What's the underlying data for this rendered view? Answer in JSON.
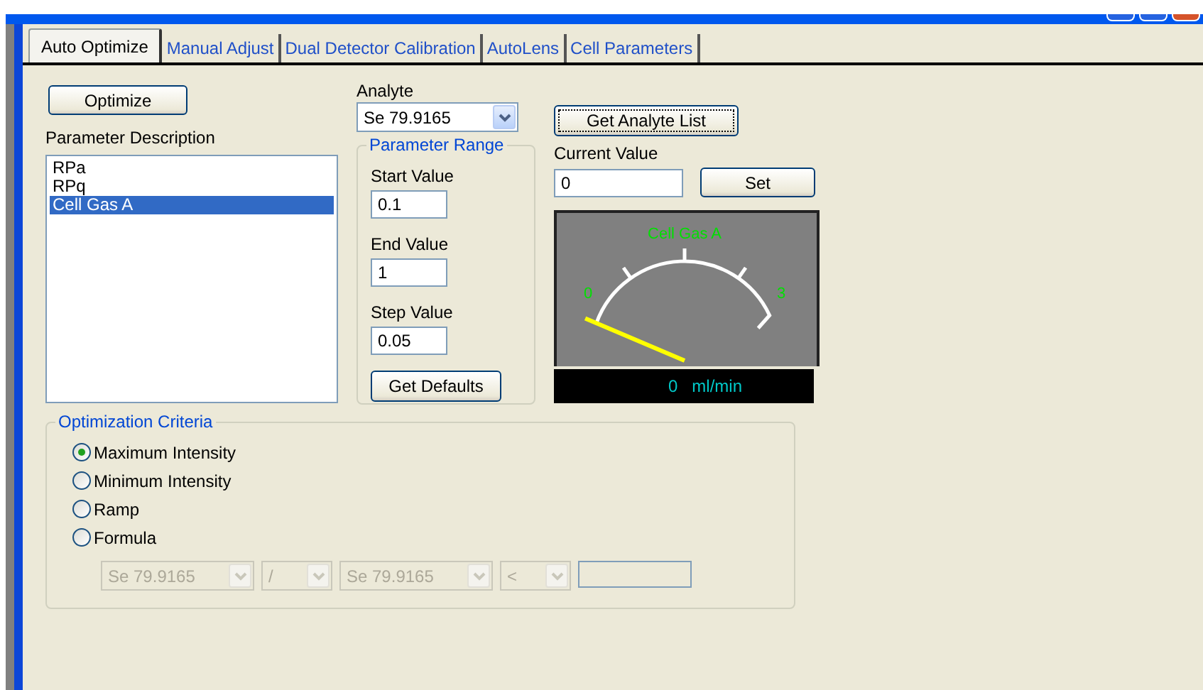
{
  "tabs": [
    {
      "label": "Auto Optimize",
      "selected": true
    },
    {
      "label": "Manual Adjust",
      "selected": false
    },
    {
      "label": "Dual Detector Calibration",
      "selected": false
    },
    {
      "label": "AutoLens",
      "selected": false
    },
    {
      "label": "Cell Parameters",
      "selected": false
    }
  ],
  "optimize_button": "Optimize",
  "parameter_list": {
    "label": "Parameter Description",
    "items": [
      {
        "label": "RPa",
        "selected": false
      },
      {
        "label": "RPq",
        "selected": false
      },
      {
        "label": "Cell Gas A",
        "selected": true
      }
    ]
  },
  "analyte": {
    "label": "Analyte",
    "value": "Se 79.9165"
  },
  "get_analyte_list_button": "Get Analyte List",
  "parameter_range": {
    "title": "Parameter Range",
    "fields": [
      {
        "label": "Start Value",
        "value": "0.1"
      },
      {
        "label": "End Value",
        "value": "1"
      },
      {
        "label": "Step Value",
        "value": "0.05"
      }
    ],
    "button": "Get Defaults"
  },
  "current_value": {
    "label": "Current Value",
    "value": "0",
    "button": "Set"
  },
  "gauge": {
    "title": "Cell Gas A",
    "min_label": "0",
    "max_label": "3",
    "reading": "0",
    "unit": "ml/min"
  },
  "optimization_criteria": {
    "title": "Optimization Criteria",
    "options": [
      {
        "label": "Maximum Intensity",
        "selected": true
      },
      {
        "label": "Minimum Intensity",
        "selected": false
      },
      {
        "label": "Ramp",
        "selected": false
      },
      {
        "label": "Formula",
        "selected": false
      }
    ],
    "formula": {
      "disabled": true,
      "parts": [
        {
          "kind": "combo",
          "value": "Se 79.9165"
        },
        {
          "kind": "combo",
          "value": "/"
        },
        {
          "kind": "combo",
          "value": "Se 79.9165"
        },
        {
          "kind": "combo",
          "value": "<"
        },
        {
          "kind": "field"
        }
      ]
    }
  }
}
